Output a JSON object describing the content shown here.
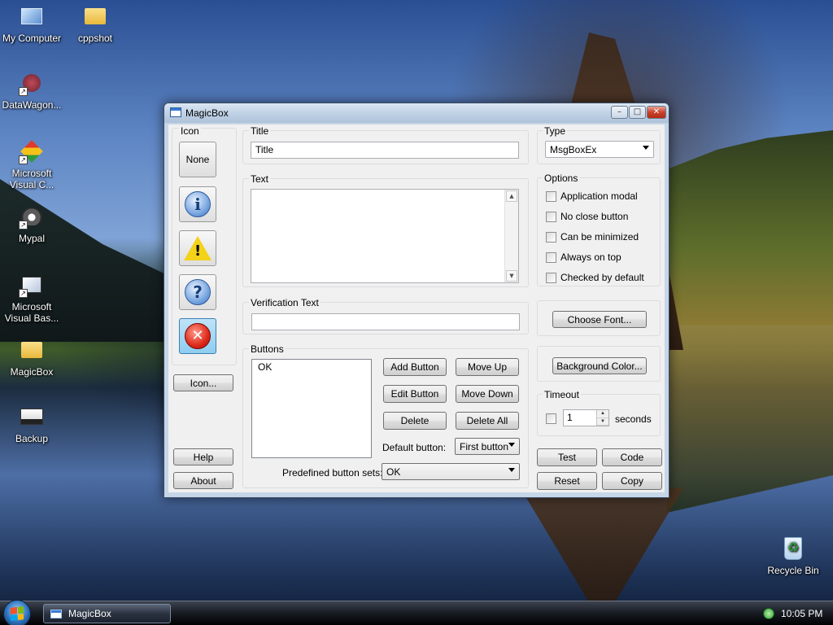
{
  "desktop": {
    "icons": [
      {
        "label": "My Computer",
        "icon": "computer-icon"
      },
      {
        "label": "cppshot",
        "icon": "folder-icon"
      },
      {
        "label": "DataWagon...",
        "icon": "shortcut-icon"
      },
      {
        "label": "Microsoft Visual C...",
        "icon": "visual-c-icon"
      },
      {
        "label": "Mypal",
        "icon": "mypal-icon"
      },
      {
        "label": "Microsoft Visual Bas...",
        "icon": "visual-basic-icon"
      },
      {
        "label": "MagicBox",
        "icon": "folder-icon"
      },
      {
        "label": "Backup",
        "icon": "backup-icon"
      },
      {
        "label": "Recycle Bin",
        "icon": "recycle-bin-icon"
      }
    ]
  },
  "window": {
    "title": "MagicBox",
    "controls": {
      "minimize": "–",
      "maximize": "□",
      "close": "✕"
    }
  },
  "icon_panel": {
    "label": "Icon",
    "none_label": "None",
    "info_glyph": "i",
    "warn_glyph": "!",
    "question_glyph": "?",
    "error_glyph": "✕",
    "icon_button": "Icon...",
    "help_button": "Help",
    "about_button": "About",
    "selected": "error"
  },
  "title_section": {
    "label": "Title",
    "value": "Title"
  },
  "text_section": {
    "label": "Text",
    "value": ""
  },
  "verification": {
    "label": "Verification Text",
    "value": ""
  },
  "buttons_section": {
    "label": "Buttons",
    "list": [
      "OK"
    ],
    "add": "Add Button",
    "move_up": "Move Up",
    "edit": "Edit Button",
    "move_down": "Move Down",
    "delete": "Delete",
    "delete_all": "Delete All",
    "default_label": "Default button:",
    "default_value": "First button",
    "predefined_label": "Predefined button sets:",
    "predefined_value": "OK"
  },
  "type_section": {
    "label": "Type",
    "value": "MsgBoxEx"
  },
  "options": {
    "label": "Options",
    "items": [
      "Application modal",
      "No close button",
      "Can be minimized",
      "Always on top",
      "Checked by default"
    ]
  },
  "choose_font": "Choose Font...",
  "background_color": "Background Color...",
  "timeout": {
    "label": "Timeout",
    "value": "1",
    "unit": "seconds",
    "up": "▲",
    "down": "▼"
  },
  "actions": {
    "test": "Test",
    "code": "Code",
    "reset": "Reset",
    "copy": "Copy"
  },
  "taskbar": {
    "item": "MagicBox",
    "clock": "10:05 PM"
  }
}
